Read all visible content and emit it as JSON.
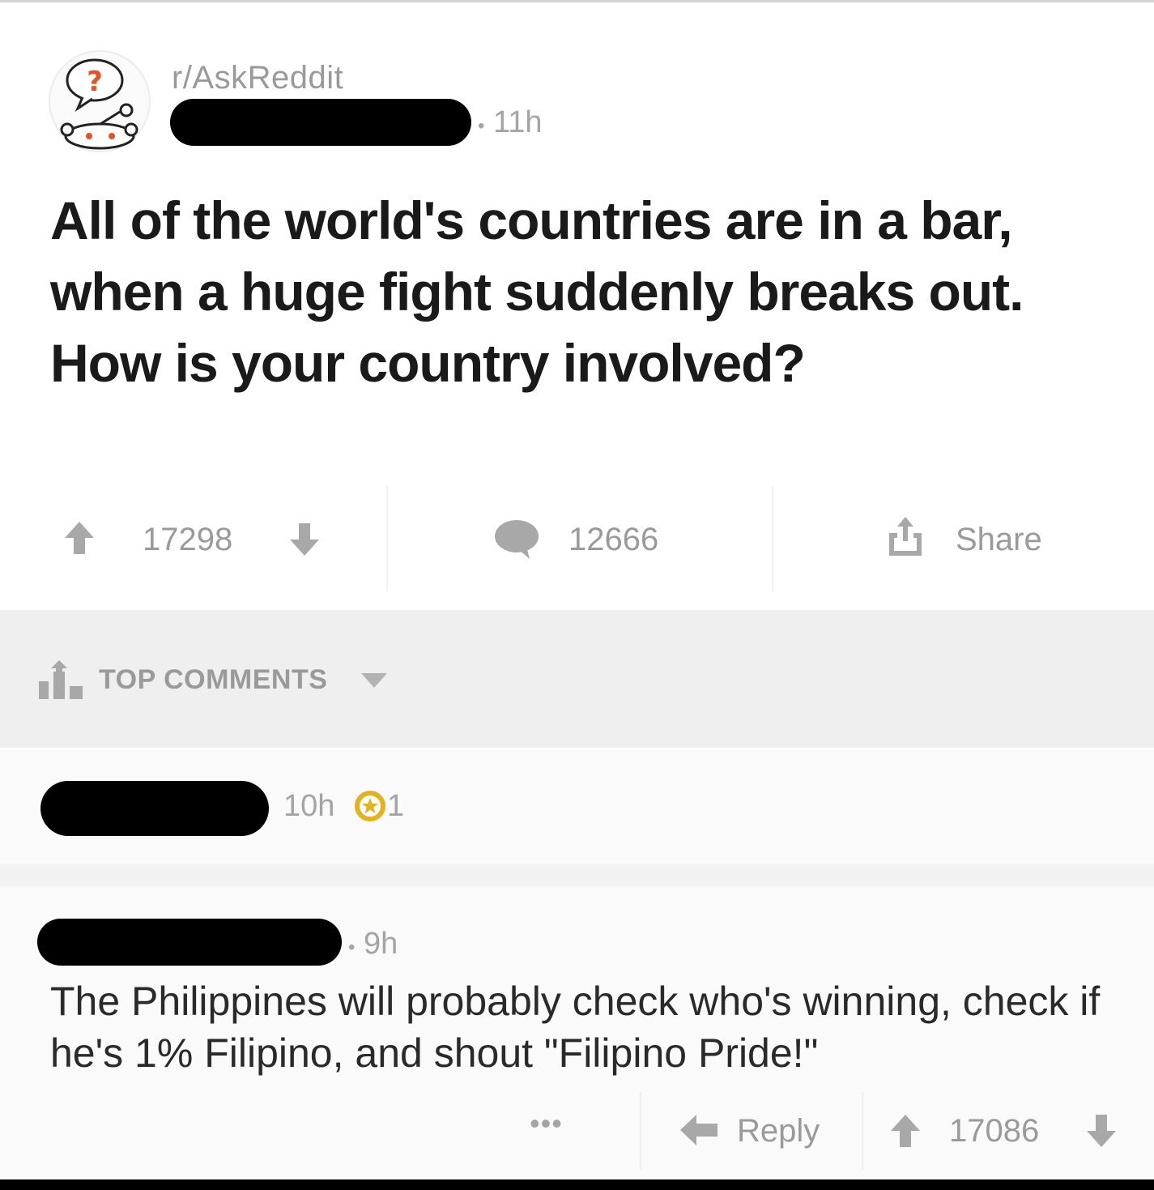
{
  "post": {
    "subreddit": "r/AskReddit",
    "time": "11h",
    "title": "All of the world's countries are in a bar, when a huge fight suddenly breaks out. How is your country involved?",
    "upvotes": "17298",
    "comments": "12666",
    "share_label": "Share"
  },
  "sort": {
    "label": "TOP COMMENTS"
  },
  "comments": [
    {
      "time": "10h",
      "award_count": "1"
    },
    {
      "time": "9h",
      "text": "The Philippines will probably check who's winning, check if he's 1% Filipino, and shout \"Filipino Pride!\"",
      "reply_label": "Reply",
      "score": "17086"
    }
  ],
  "colors": {
    "award": "#e3b21e",
    "avatar_question": "#e8521e",
    "muted": "#9a9a9a"
  }
}
